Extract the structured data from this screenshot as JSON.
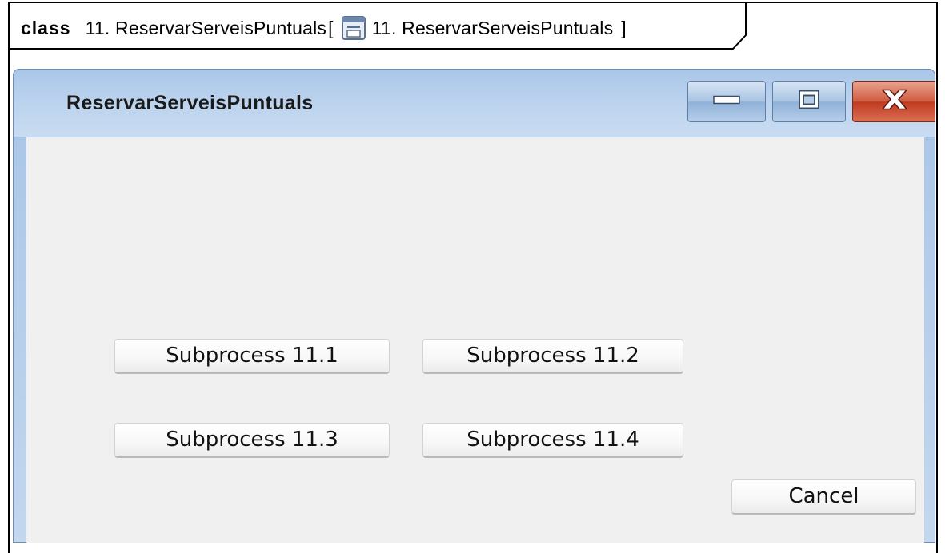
{
  "frame": {
    "keyword": "class",
    "name": "11. ReservarServeisPuntuals",
    "open_bracket": "[",
    "diagram_name": "11. ReservarServeisPuntuals",
    "close_bracket": "]",
    "diagram_icon": "diagram-icon"
  },
  "window": {
    "title": "ReservarServeisPuntuals",
    "controls": [
      "minimize-icon",
      "maximize-icon",
      "close-icon"
    ]
  },
  "buttons": {
    "sub_11_1": "Subprocess 11.1",
    "sub_11_2": "Subprocess 11.2",
    "sub_11_3": "Subprocess 11.3",
    "sub_11_4": "Subprocess 11.4",
    "cancel": "Cancel"
  }
}
